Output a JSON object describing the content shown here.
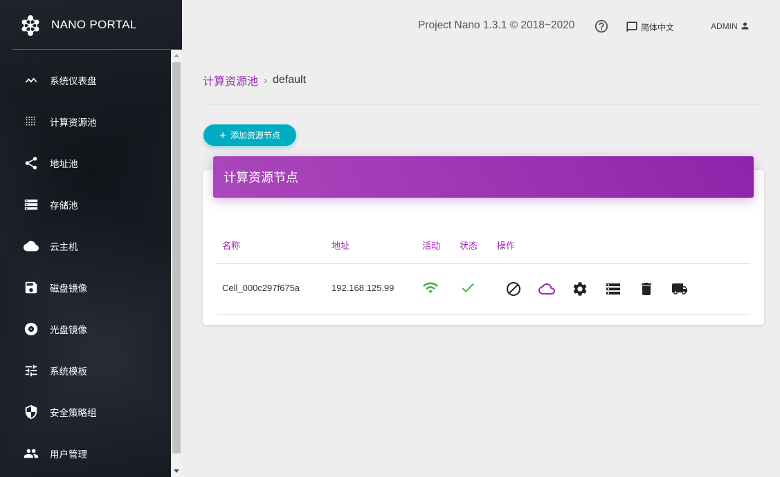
{
  "brand": {
    "name": "NANO PORTAL"
  },
  "sidebar": {
    "items": [
      {
        "label": "系统仪表盘",
        "icon": "dashboard-trend-icon"
      },
      {
        "label": "计算资源池",
        "icon": "grid-dots-icon"
      },
      {
        "label": "地址池",
        "icon": "share-icon"
      },
      {
        "label": "存储池",
        "icon": "storage-icon"
      },
      {
        "label": "云主机",
        "icon": "cloud-icon"
      },
      {
        "label": "磁盘镜像",
        "icon": "save-disk-icon"
      },
      {
        "label": "光盘镜像",
        "icon": "album-disc-icon"
      },
      {
        "label": "系统模板",
        "icon": "tune-sliders-icon"
      },
      {
        "label": "安全策略组",
        "icon": "shield-icon"
      },
      {
        "label": "用户管理",
        "icon": "people-icon"
      }
    ]
  },
  "topbar": {
    "version": "Project Nano 1.3.1 © 2018~2020",
    "language": "简体中文",
    "user": "ADMIN"
  },
  "breadcrumb": {
    "parent": "计算资源池",
    "separator": "›",
    "current": "default"
  },
  "add_button": {
    "label": "添加资源节点"
  },
  "card": {
    "title": "计算资源节点",
    "columns": [
      "名称",
      "地址",
      "活动",
      "状态",
      "操作"
    ],
    "rows": [
      {
        "name": "Cell_000c297f675a",
        "address": "192.168.125.99",
        "alive_icon": "wifi-icon",
        "status_icon": "check-icon"
      }
    ],
    "actions": [
      "block-icon",
      "cloud-outline-icon",
      "settings-gear-icon",
      "storage-list-icon",
      "delete-trash-icon",
      "truck-migrate-icon"
    ]
  },
  "colors": {
    "accent": "#9c27b0",
    "primary_button": "#00acc1",
    "alive": "#4caf50",
    "status_ok": "#4caf50"
  }
}
